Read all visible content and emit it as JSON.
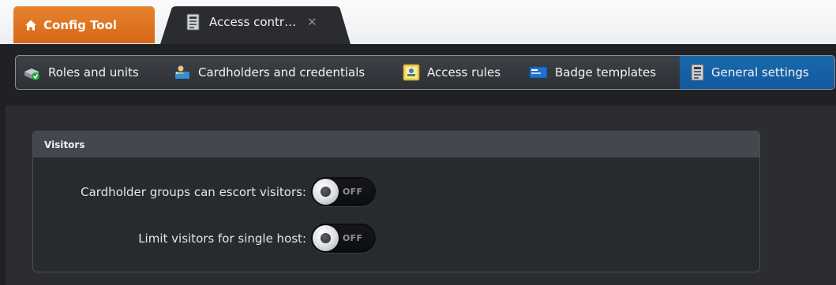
{
  "tabs": {
    "home": {
      "label": "Config Tool",
      "icon": "home-icon"
    },
    "active": {
      "label": "Access contr…",
      "icon": "document-icon",
      "close_glyph": "✕"
    }
  },
  "sections": [
    {
      "label": "Roles and units",
      "icon": "roles-units-icon"
    },
    {
      "label": "Cardholders and credentials",
      "icon": "cardholder-icon"
    },
    {
      "label": "Access rules",
      "icon": "access-rules-icon"
    },
    {
      "label": "Badge templates",
      "icon": "badge-template-icon"
    },
    {
      "label": "General settings",
      "icon": "general-settings-icon",
      "selected": true
    }
  ],
  "visitors": {
    "title": "Visitors",
    "settings": [
      {
        "label": "Cardholder groups can escort visitors:",
        "state": "OFF",
        "enabled": false
      },
      {
        "label": "Limit visitors for single host:",
        "state": "OFF",
        "enabled": false
      }
    ]
  },
  "colors": {
    "home_tab": "#de7420",
    "selected_section": "#1660a6",
    "background": "#1f2124"
  }
}
